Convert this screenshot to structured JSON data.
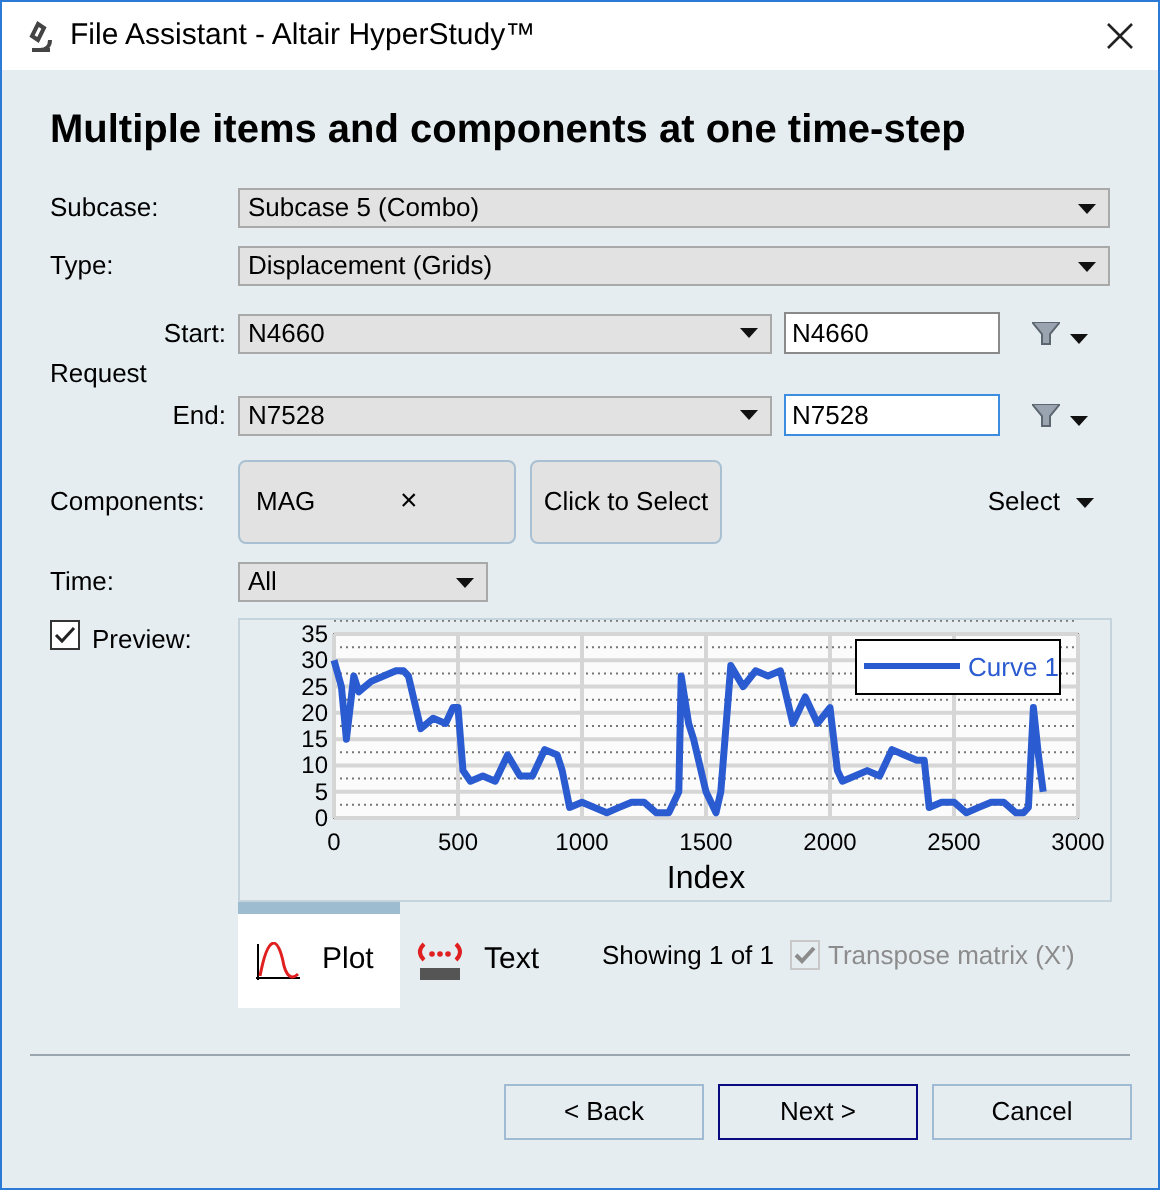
{
  "window": {
    "title": "File Assistant - Altair HyperStudy™"
  },
  "heading": "Multiple items and components at one time-step",
  "subcase": {
    "label": "Subcase:",
    "value": "Subcase 5 (Combo)"
  },
  "type": {
    "label": "Type:",
    "value": "Displacement (Grids)"
  },
  "request": {
    "label": "Request",
    "rows": [
      {
        "label": "Start:",
        "value": "N4660",
        "field": "N4660",
        "focused": false
      },
      {
        "label": "End:",
        "value": "N7528",
        "field": "N7528",
        "focused": true
      }
    ]
  },
  "components": {
    "label": "Components:",
    "chips": [
      "MAG"
    ],
    "remove": "×",
    "select_button": "Click to Select",
    "menu": "Select"
  },
  "time": {
    "label": "Time:",
    "value": "All"
  },
  "preview": {
    "label": "Preview:",
    "checked": true
  },
  "chart_data": {
    "type": "line",
    "xlabel": "Index",
    "x": [
      0,
      30,
      50,
      80,
      100,
      150,
      200,
      250,
      280,
      300,
      350,
      400,
      450,
      480,
      500,
      520,
      550,
      600,
      650,
      700,
      750,
      800,
      850,
      900,
      920,
      950,
      1000,
      1050,
      1100,
      1150,
      1200,
      1250,
      1300,
      1350,
      1390,
      1400,
      1430,
      1450,
      1500,
      1540,
      1560,
      1600,
      1650,
      1700,
      1750,
      1800,
      1850,
      1900,
      1950,
      2000,
      2030,
      2050,
      2100,
      2150,
      2200,
      2250,
      2300,
      2350,
      2380,
      2400,
      2450,
      2500,
      2550,
      2600,
      2650,
      2700,
      2750,
      2780,
      2800,
      2820,
      2840,
      2860
    ],
    "series": [
      {
        "name": "Curve 1",
        "color": "#2a5bd0",
        "values": [
          30,
          25,
          15,
          27,
          24,
          26,
          27,
          28,
          28,
          27,
          17,
          19,
          18,
          21,
          21,
          9,
          7,
          8,
          7,
          12,
          8,
          8,
          13,
          12,
          9,
          2,
          3,
          2,
          1,
          2,
          3,
          3,
          1,
          1,
          5,
          27,
          18,
          15,
          5,
          1,
          5,
          29,
          25,
          28,
          27,
          28,
          18,
          23,
          18,
          21,
          9,
          7,
          8,
          9,
          8,
          13,
          12,
          11,
          11,
          2,
          3,
          3,
          1,
          2,
          3,
          3,
          1,
          1,
          2,
          21,
          12,
          5
        ]
      }
    ],
    "grid": true,
    "xlim": [
      0,
      3000
    ],
    "ylim": [
      0,
      35
    ],
    "xticks": [
      0,
      500,
      1000,
      1500,
      2000,
      2500,
      3000
    ],
    "yticks": [
      0,
      5,
      10,
      15,
      20,
      25,
      30,
      35
    ]
  },
  "view_tabs": [
    {
      "label": "Plot",
      "kind": "plot",
      "selected": true
    },
    {
      "label": "Text",
      "kind": "text",
      "selected": false
    }
  ],
  "showing": "Showing 1 of 1",
  "transpose": {
    "label": "Transpose matrix (X')",
    "checked": true,
    "disabled": true
  },
  "buttons": [
    {
      "label": "< Back",
      "default": false
    },
    {
      "label": "Next >",
      "default": true
    },
    {
      "label": "Cancel",
      "default": false
    }
  ]
}
